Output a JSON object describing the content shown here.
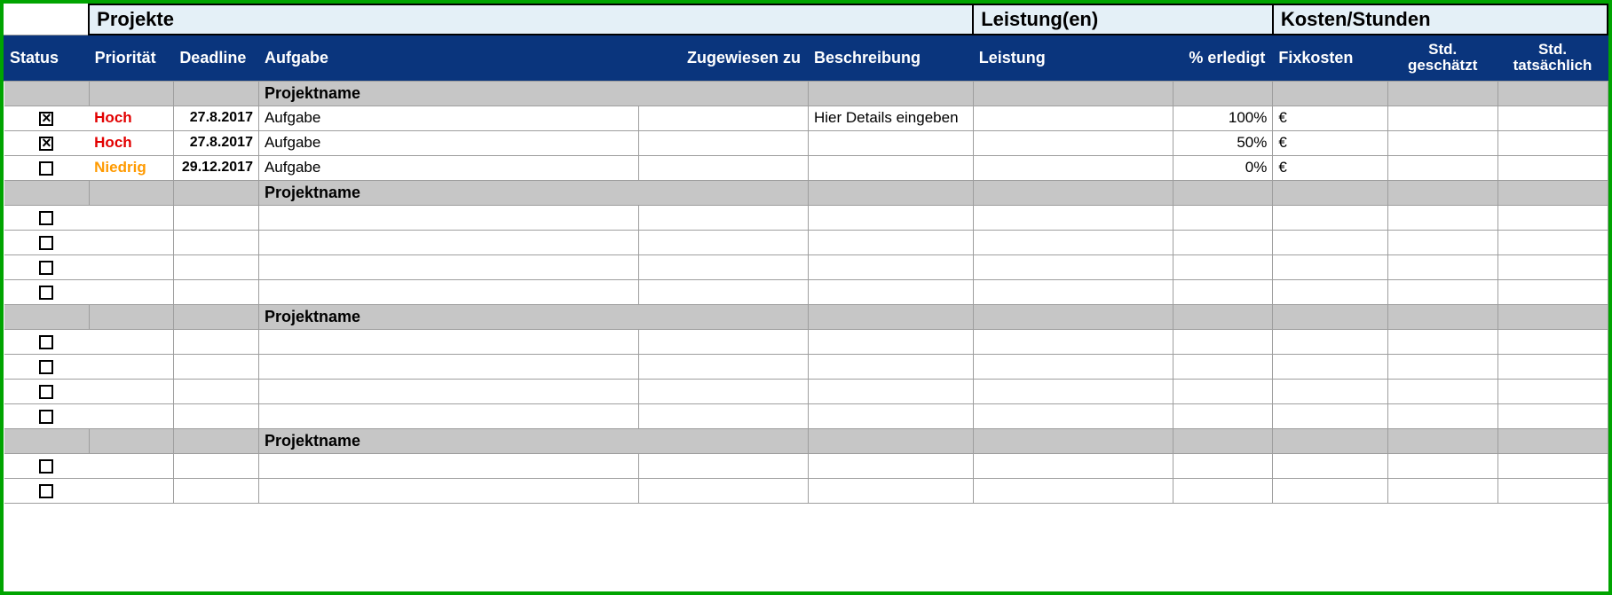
{
  "sections": {
    "projekte": "Projekte",
    "leistungen": "Leistung(en)",
    "kosten": "Kosten/Stunden"
  },
  "columns": {
    "status": "Status",
    "prioritaet": "Priorität",
    "deadline": "Deadline",
    "aufgabe": "Aufgabe",
    "zugewiesen": "Zugewiesen zu",
    "beschreibung": "Beschreibung",
    "leistung": "Leistung",
    "erledigt": "% erledigt",
    "fixkosten": "Fixkosten",
    "std_geschaetzt_l1": "Std.",
    "std_geschaetzt_l2": "geschätzt",
    "std_tatsaechlich_l1": "Std.",
    "std_tatsaechlich_l2": "tatsächlich"
  },
  "groups": [
    {
      "name": "Projektname",
      "rows": [
        {
          "checked": true,
          "prio": "Hoch",
          "prio_class": "hoch",
          "deadline": "27.8.2017",
          "aufgabe": "Aufgabe",
          "beschreibung": "Hier Details eingeben",
          "erledigt": "100%",
          "fix": "€"
        },
        {
          "checked": true,
          "prio": "Hoch",
          "prio_class": "hoch",
          "deadline": "27.8.2017",
          "aufgabe": "Aufgabe",
          "beschreibung": "",
          "erledigt": "50%",
          "fix": "€"
        },
        {
          "checked": false,
          "prio": "Niedrig",
          "prio_class": "niedrig",
          "deadline": "29.12.2017",
          "aufgabe": "Aufgabe",
          "beschreibung": "",
          "erledigt": "0%",
          "fix": "€"
        }
      ]
    },
    {
      "name": "Projektname",
      "rows": [
        {
          "checked": false,
          "prio": "",
          "prio_class": "",
          "deadline": "",
          "aufgabe": "",
          "beschreibung": "",
          "erledigt": "",
          "fix": ""
        },
        {
          "checked": false,
          "prio": "",
          "prio_class": "",
          "deadline": "",
          "aufgabe": "",
          "beschreibung": "",
          "erledigt": "",
          "fix": ""
        },
        {
          "checked": false,
          "prio": "",
          "prio_class": "",
          "deadline": "",
          "aufgabe": "",
          "beschreibung": "",
          "erledigt": "",
          "fix": ""
        },
        {
          "checked": false,
          "prio": "",
          "prio_class": "",
          "deadline": "",
          "aufgabe": "",
          "beschreibung": "",
          "erledigt": "",
          "fix": ""
        }
      ]
    },
    {
      "name": "Projektname",
      "rows": [
        {
          "checked": false,
          "prio": "",
          "prio_class": "",
          "deadline": "",
          "aufgabe": "",
          "beschreibung": "",
          "erledigt": "",
          "fix": ""
        },
        {
          "checked": false,
          "prio": "",
          "prio_class": "",
          "deadline": "",
          "aufgabe": "",
          "beschreibung": "",
          "erledigt": "",
          "fix": ""
        },
        {
          "checked": false,
          "prio": "",
          "prio_class": "",
          "deadline": "",
          "aufgabe": "",
          "beschreibung": "",
          "erledigt": "",
          "fix": ""
        },
        {
          "checked": false,
          "prio": "",
          "prio_class": "",
          "deadline": "",
          "aufgabe": "",
          "beschreibung": "",
          "erledigt": "",
          "fix": ""
        }
      ]
    },
    {
      "name": "Projektname",
      "rows": [
        {
          "checked": false,
          "prio": "",
          "prio_class": "",
          "deadline": "",
          "aufgabe": "",
          "beschreibung": "",
          "erledigt": "",
          "fix": ""
        },
        {
          "checked": false,
          "prio": "",
          "prio_class": "",
          "deadline": "",
          "aufgabe": "",
          "beschreibung": "",
          "erledigt": "",
          "fix": ""
        }
      ]
    }
  ]
}
